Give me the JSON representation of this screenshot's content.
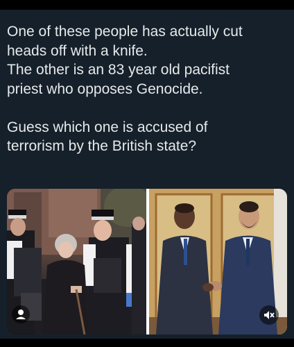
{
  "tweet": {
    "lines": [
      "One of these people has actually cut",
      "heads off with a knife.",
      "The other is an 83 year old pacifist",
      "priest who opposes Genocide.",
      "",
      "Guess which one is accused of",
      "terrorism by the British state?"
    ]
  },
  "media": {
    "left_image": "photo-elderly-woman-with-police-officers",
    "right_image": "photo-two-men-shaking-hands",
    "icons": {
      "mute": "speaker-muted-icon",
      "tagged_person": "person-icon"
    }
  },
  "colors": {
    "background": "#15202b",
    "text": "#e7e9ea"
  }
}
